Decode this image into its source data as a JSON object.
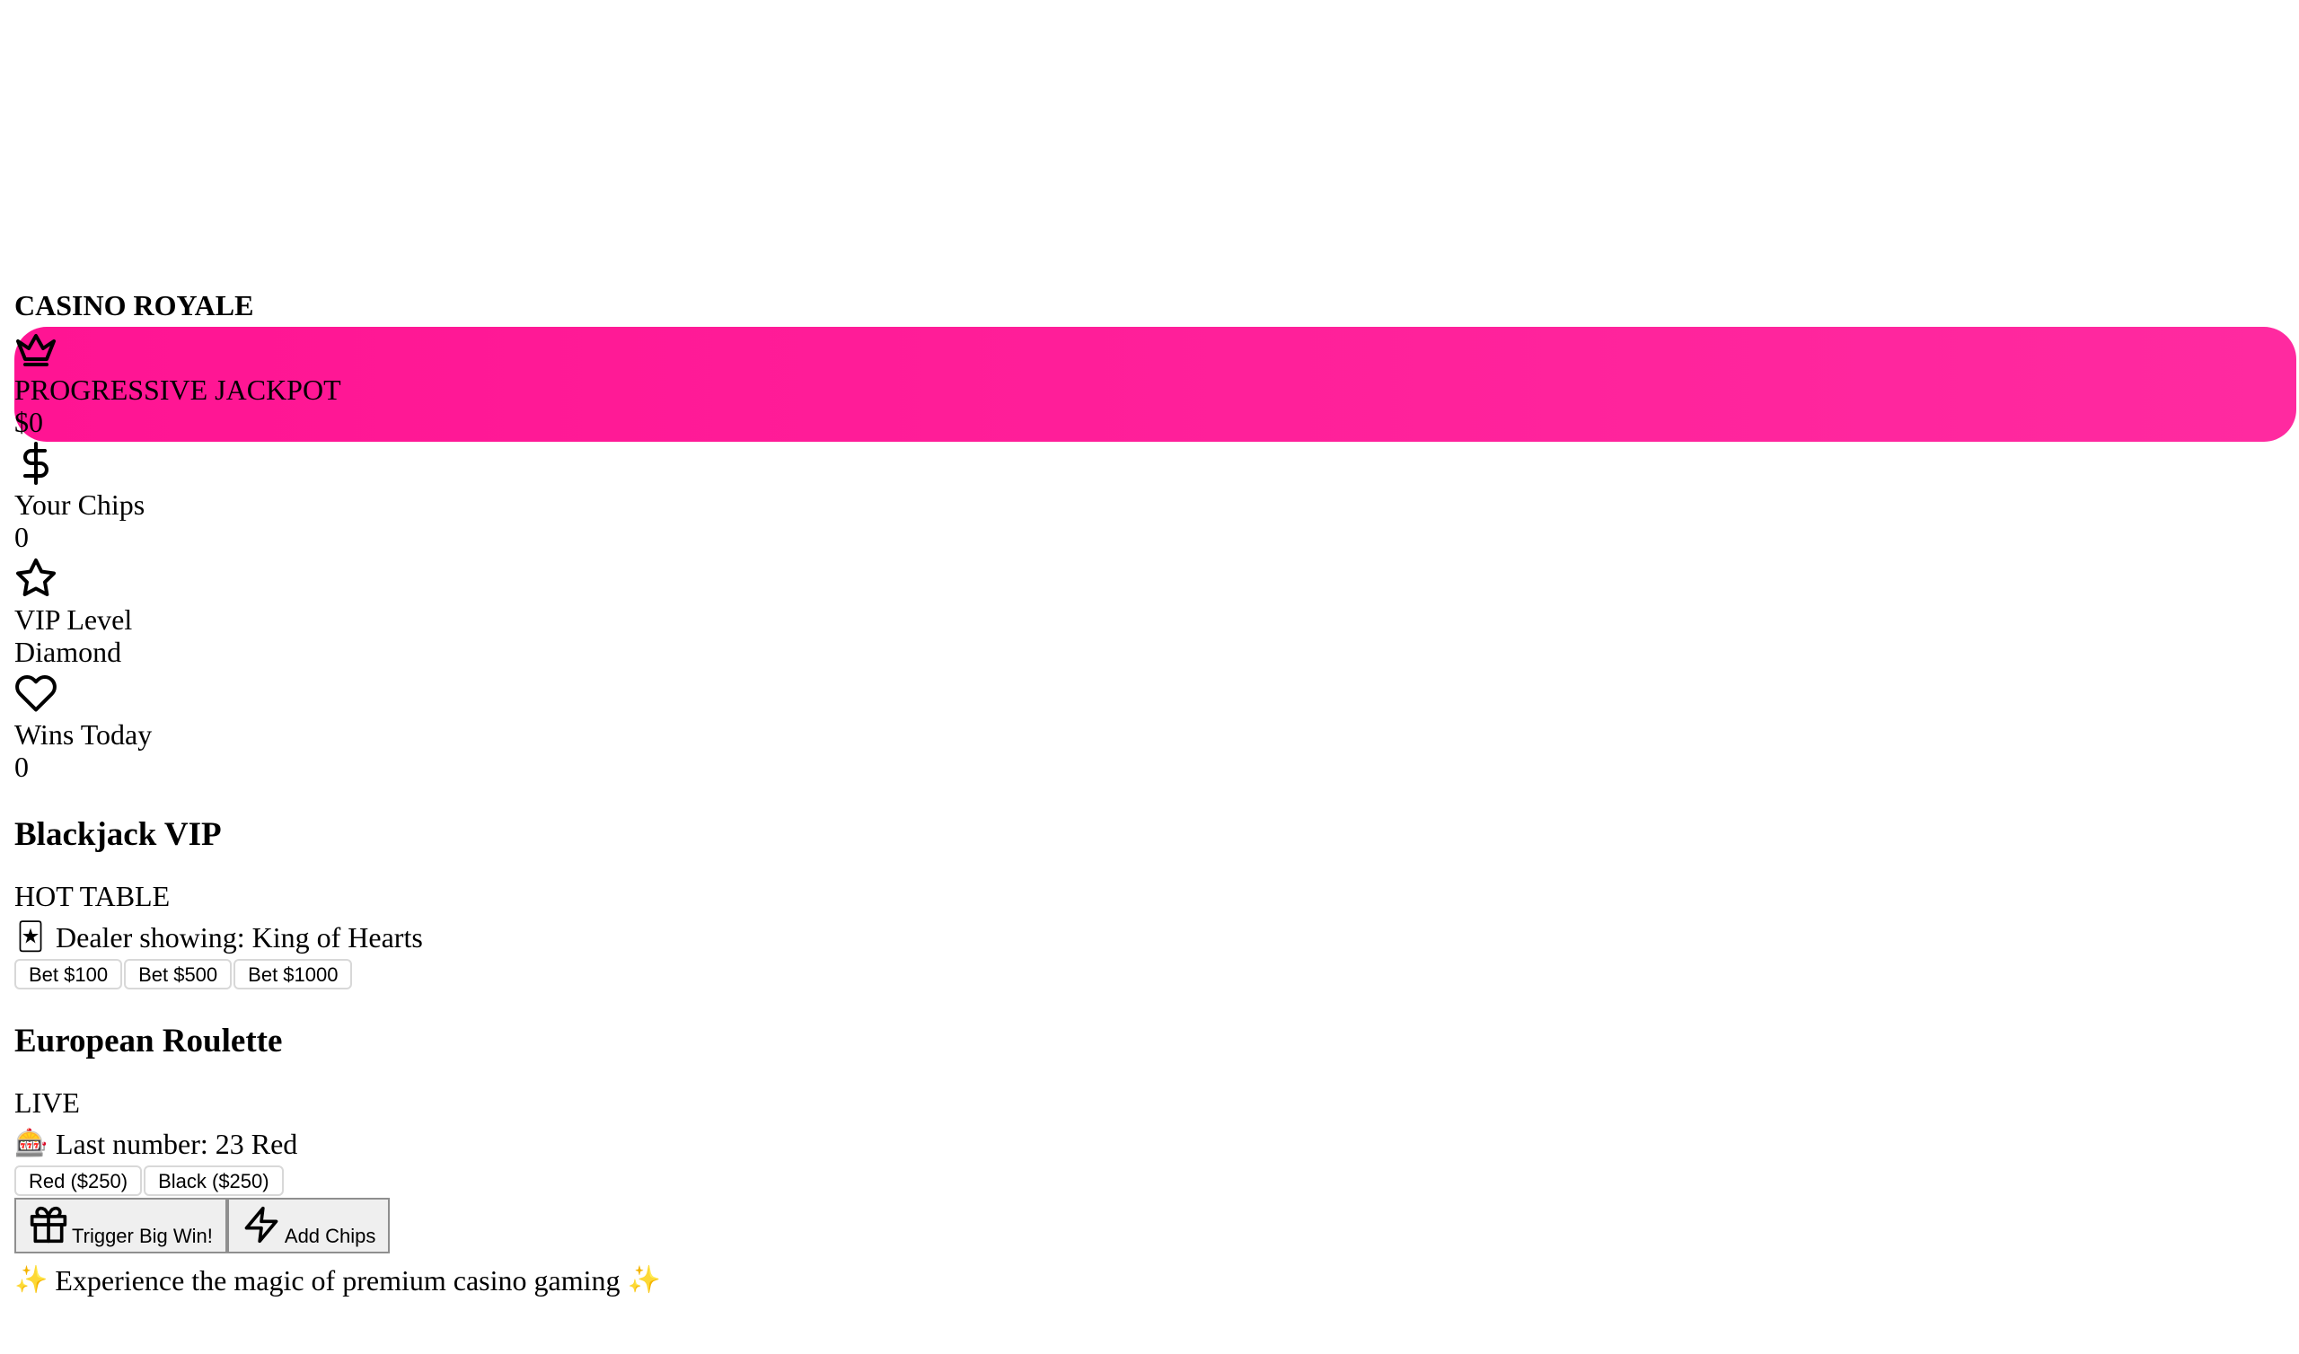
{
  "app": {
    "title": "CASINO ROYALE"
  },
  "stats": {
    "jackpot": {
      "icon": "crown-icon",
      "label": "PROGRESSIVE JACKPOT",
      "value": "$0"
    },
    "chips": {
      "icon": "dollar-icon",
      "label": "Your Chips",
      "value": "0"
    },
    "vip": {
      "icon": "star-icon",
      "label": "VIP Level",
      "value": "Diamond"
    },
    "wins": {
      "icon": "heart-icon",
      "label": "Wins Today",
      "value": "0"
    }
  },
  "tables": [
    {
      "name": "Blackjack VIP",
      "badge": "HOT TABLE",
      "info_icon": "🃏",
      "info": "Dealer showing: King of Hearts",
      "bets": [
        "Bet $100",
        "Bet $500",
        "Bet $1000"
      ]
    },
    {
      "name": "European Roulette",
      "badge": "LIVE",
      "info_icon": "🎰",
      "info": "Last number: 23 Red",
      "bets": [
        "Red ($250)",
        "Black ($250)"
      ]
    }
  ],
  "actions": {
    "big_win": {
      "icon": "gift-icon",
      "label": "Trigger Big Win!"
    },
    "add_chips": {
      "icon": "lightning-icon",
      "label": "Add Chips"
    }
  },
  "footer": {
    "sparkle": "✨",
    "text": "Experience the magic of premium casino gaming"
  },
  "colors": {
    "jackpot_bg": "#ff1493"
  }
}
